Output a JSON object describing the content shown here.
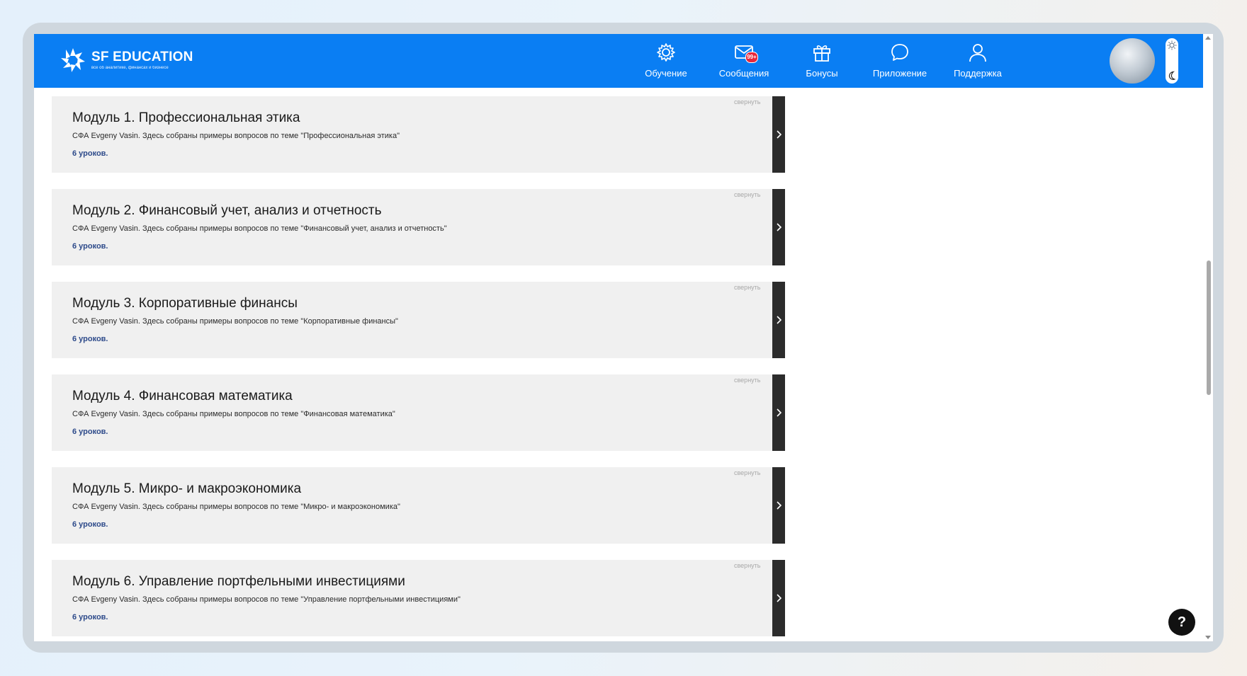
{
  "header": {
    "logo_title": "SF EDUCATION",
    "logo_subtitle": "все об аналитике, финансах и бизнесе",
    "nav": [
      {
        "label": "Обучение",
        "icon": "gear-icon"
      },
      {
        "label": "Сообщения",
        "icon": "mail-icon",
        "badge": "99+"
      },
      {
        "label": "Бонусы",
        "icon": "gift-icon"
      },
      {
        "label": "Приложение",
        "icon": "chat-bubble-icon"
      },
      {
        "label": "Поддержка",
        "icon": "user-icon"
      }
    ],
    "accent_color": "#0a7ef3"
  },
  "modules": [
    {
      "title": "Модуль 1. Профессиональная этика",
      "description": "СФА Evgeny Vasin. Здесь собраны примеры вопросов по теме \"Профессиональная этика\"",
      "lessons": "6 уроков.",
      "collapse": "свернуть"
    },
    {
      "title": "Модуль 2. Финансовый учет, анализ и отчетность",
      "description": "СФА Evgeny Vasin. Здесь собраны примеры вопросов по теме \"Финансовый учет, анализ и отчетность\"",
      "lessons": "6 уроков.",
      "collapse": "свернуть"
    },
    {
      "title": "Модуль 3. Корпоративные финансы",
      "description": "СФА Evgeny Vasin. Здесь собраны примеры вопросов по теме \"Корпоративные финансы\"",
      "lessons": "6 уроков.",
      "collapse": "свернуть"
    },
    {
      "title": "Модуль 4. Финансовая математика",
      "description": "СФА Evgeny Vasin. Здесь собраны примеры вопросов по теме \"Финансовая математика\"",
      "lessons": "6 уроков.",
      "collapse": "свернуть"
    },
    {
      "title": "Модуль 5. Микро- и макроэкономика",
      "description": "СФА Evgeny Vasin. Здесь собраны примеры вопросов по теме \"Микро- и макроэкономика\"",
      "lessons": "6 уроков.",
      "collapse": "свернуть"
    },
    {
      "title": "Модуль 6. Управление портфельными инвестициями",
      "description": "СФА Evgeny Vasin. Здесь собраны примеры вопросов по теме \"Управление портфельными инвестициями\"",
      "lessons": "6 уроков.",
      "collapse": "свернуть"
    }
  ],
  "help": {
    "label": "?"
  }
}
